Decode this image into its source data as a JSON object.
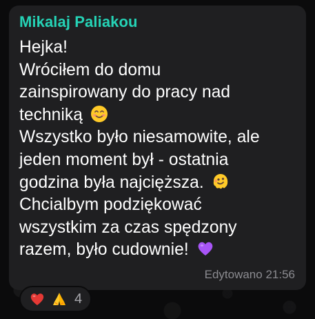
{
  "message": {
    "sender": "Mikalaj Paliakou",
    "lines": [
      "Hejka!",
      "Wróciłem do domu",
      "zainspirowany do pracy nad",
      "techniką",
      "Wszystko było niesamowite, ale",
      "jeden moment był - ostatnia",
      "godzina była najcięższa.",
      "Chcialbym podziękować",
      "wszystkim za czas spędzony",
      "razem, było cudownie!"
    ],
    "inline_emojis": [
      "smiling-face-emoji",
      "melting-face-emoji",
      "purple-heart-emoji"
    ],
    "status": "Edytowano 21:56"
  },
  "reactions": {
    "items": [
      "red-heart",
      "folded-hands"
    ],
    "count": "4"
  },
  "colors": {
    "background": "#0b0b0c",
    "bubble": "#1f1f21",
    "sender_name": "#25d3b6",
    "text": "#ffffff",
    "meta": "#8b8b90"
  }
}
